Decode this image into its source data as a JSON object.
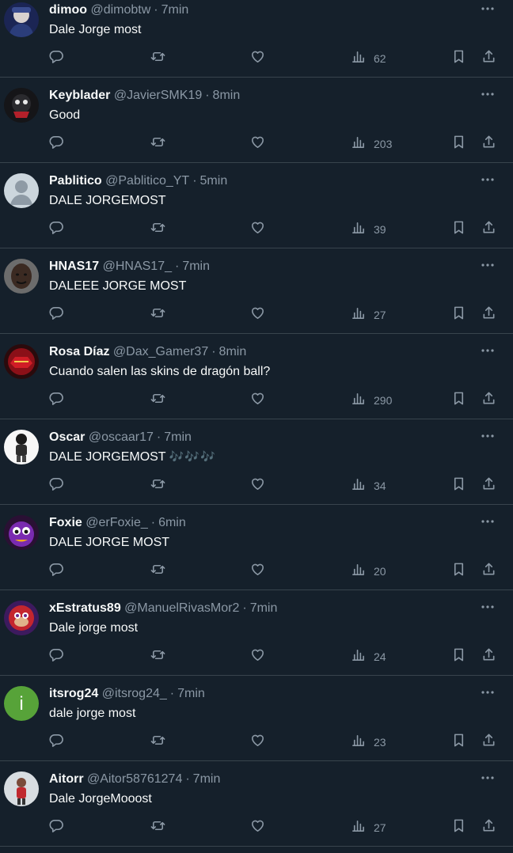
{
  "colors": {
    "background": "#15202b",
    "divider": "#38444d",
    "text_primary": "#f7f9f9",
    "text_secondary": "#8b98a5",
    "accent": "#1d9bf0"
  },
  "icons": {
    "more": "more-horizontal-icon",
    "reply": "reply-icon",
    "retweet": "retweet-icon",
    "like": "heart-icon",
    "views": "views-chart-icon",
    "bookmark": "bookmark-icon",
    "share": "share-icon"
  },
  "tweets": [
    {
      "name": "dimoo",
      "handle": "@dimobtw",
      "sep": "·",
      "time": "7min",
      "text": "Dale Jorge most",
      "emoji": "",
      "views": "62",
      "avatar": "photo-dark-blue"
    },
    {
      "name": "Keyblader",
      "handle": "@JavierSMK19",
      "sep": "·",
      "time": "8min",
      "text": "Good",
      "emoji": "",
      "views": "203",
      "avatar": "photo-dark-red"
    },
    {
      "name": "Pablitico",
      "handle": "@Pablitico_YT",
      "sep": "·",
      "time": "5min",
      "text": "DALE JORGEMOST",
      "emoji": "",
      "views": "39",
      "avatar": "default-profile"
    },
    {
      "name": "HNAS17",
      "handle": "@HNAS17_",
      "sep": "·",
      "time": "7min",
      "text": "DALEEE JORGE  MOST",
      "emoji": "",
      "views": "27",
      "avatar": "photo-face"
    },
    {
      "name": "Rosa Díaz",
      "handle": "@Dax_Gamer37",
      "sep": "·",
      "time": "8min",
      "text": "Cuando salen las skins de dragón ball?",
      "emoji": "",
      "views": "290",
      "avatar": "photo-red-logo"
    },
    {
      "name": "Oscar",
      "handle": "@oscaar17",
      "sep": "·",
      "time": "7min",
      "text": "DALE JORGEMOST ",
      "emoji": "🎶🎶🎶",
      "views": "34",
      "avatar": "photo-white-figure"
    },
    {
      "name": "Foxie",
      "handle": "@erFoxie_",
      "sep": "·",
      "time": "6min",
      "text": "DALE JORGE MOST",
      "emoji": "",
      "views": "20",
      "avatar": "photo-purple-character"
    },
    {
      "name": "xEstratus89",
      "handle": "@ManuelRivasMor2",
      "sep": "·",
      "time": "7min",
      "text": "Dale jorge most",
      "emoji": "",
      "views": "24",
      "avatar": "photo-red-knuckles"
    },
    {
      "name": "itsrog24",
      "handle": "@itsrog24_",
      "sep": "·",
      "time": "7min",
      "text": "dale jorge most",
      "emoji": "",
      "views": "23",
      "avatar": "letter-avatar",
      "avatar_letter": "i"
    },
    {
      "name": "Aitorr",
      "handle": "@Aitor58761274",
      "sep": "·",
      "time": "7min",
      "text": "Dale JorgeMooost",
      "emoji": "",
      "views": "27",
      "avatar": "photo-person"
    }
  ]
}
